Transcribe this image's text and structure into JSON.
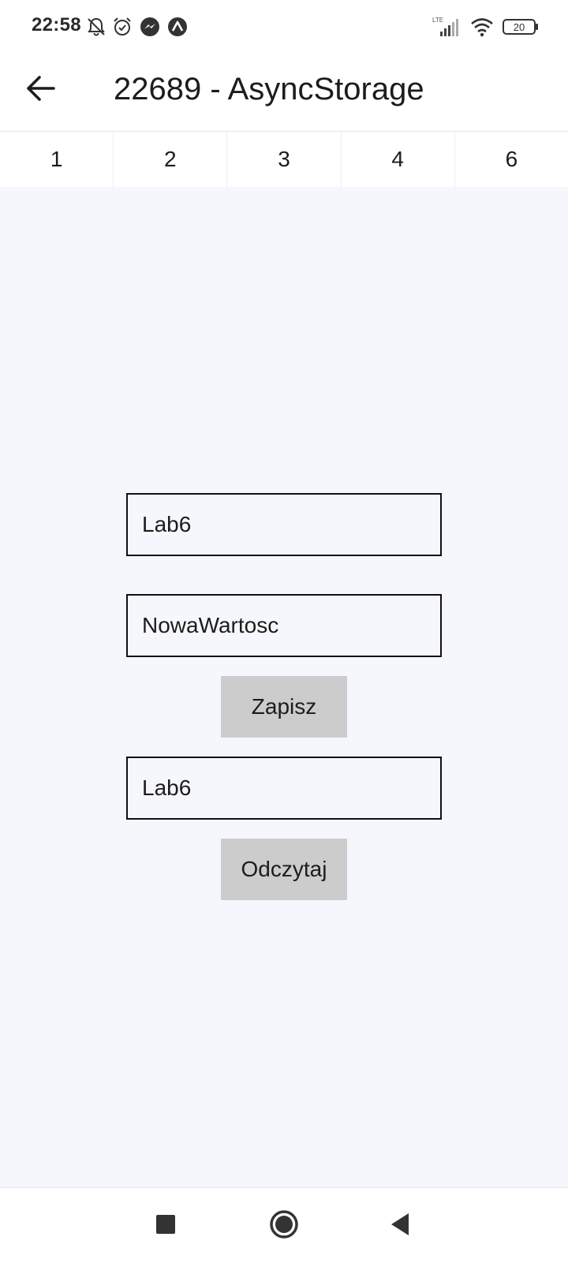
{
  "status_bar": {
    "time": "22:58",
    "network_label": "LTE",
    "battery_level": "20",
    "left_icons": [
      "bell-off-icon",
      "alarm-icon",
      "messenger-icon",
      "expo-icon"
    ],
    "right_icons": [
      "signal-icon",
      "wifi-icon",
      "battery-icon"
    ]
  },
  "header": {
    "title": "22689 - AsyncStorage",
    "back_icon": "arrow-left-icon"
  },
  "tabs": [
    {
      "label": "1"
    },
    {
      "label": "2"
    },
    {
      "label": "3"
    },
    {
      "label": "4"
    },
    {
      "label": "6"
    }
  ],
  "form": {
    "key_input_value": "Lab6",
    "value_input_value": "NowaWartosc",
    "save_button_label": "Zapisz",
    "read_key_input_value": "Lab6",
    "read_button_label": "Odczytaj"
  },
  "nav_bar": {
    "icons": [
      "recents-square-icon",
      "home-circle-icon",
      "back-triangle-icon"
    ]
  },
  "colors": {
    "content_background": "#f6f7fc",
    "button_background": "#cccccc",
    "field_border": "#111111"
  }
}
